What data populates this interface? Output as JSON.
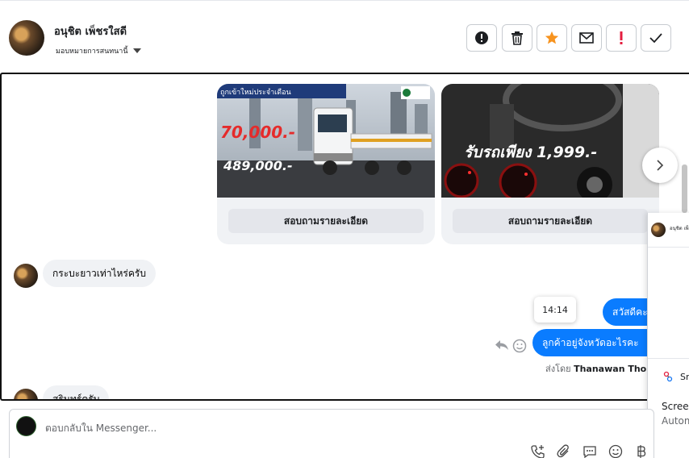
{
  "header": {
    "contact_name": "อนุชิต เพ็ชรใสดี",
    "assign_label": "มอบหมายการสนทนานี้",
    "toolbar": [
      "alert-circle-icon",
      "trash-icon",
      "star-icon",
      "mail-icon",
      "exclamation-icon",
      "check-icon"
    ]
  },
  "cards": [
    {
      "image": {
        "banner": "ถูกเข้าใหม่ประจำเดือน",
        "price_tag": "70,000.-",
        "price_main": "489,000.-"
      },
      "button_label": "สอบถามรายละเอียด"
    },
    {
      "image": {
        "price_text": "รับรถเพียง 1,999.-"
      },
      "button_label": "สอบถามรายละเอียด"
    }
  ],
  "messages": [
    {
      "direction": "in",
      "text": "กระบะยาวเท่าไหร่ครับ"
    },
    {
      "direction": "out",
      "text": "สวัสดีคะ"
    },
    {
      "direction": "out",
      "text": "ลูกค้าอยู่จังหวัดอะไรคะ"
    },
    {
      "direction": "in",
      "text": "สุรินทร์ครับ"
    }
  ],
  "tooltip_time": "14:14",
  "sent_by": {
    "prefix": "ส่งโดย",
    "name": "Thanawan Thon"
  },
  "side_panel": {
    "name": "อนุชิต เพ็",
    "item_label": "Sn",
    "line1": "Screen",
    "line2": "Autom"
  },
  "composer": {
    "placeholder": "ตอบกลับใน Messenger..."
  },
  "colors": {
    "accent": "#0a7cff",
    "star": "#f7931e",
    "danger": "#e41e3f"
  }
}
